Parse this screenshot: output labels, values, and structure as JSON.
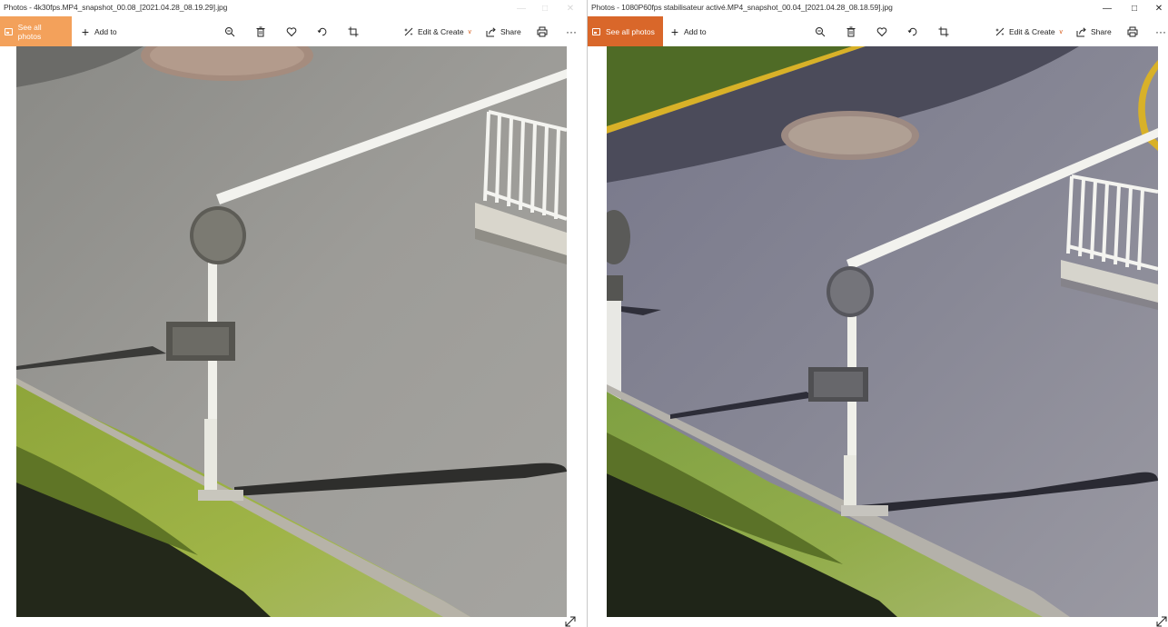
{
  "windows": [
    {
      "title": "Photos - 4k30fps.MP4_snapshot_00.08_[2021.04.28_08.19.29].jpg",
      "see_all_label": "See all photos",
      "add_to_label": "Add to",
      "edit_create_label": "Edit & Create",
      "share_label": "Share",
      "accent": "#f3a15b",
      "photo_alt": "4k30fps snapshot: street sign post on asphalt beside grass verge"
    },
    {
      "title": "Photos - 1080P60fps stabilisateur activé.MP4_snapshot_00.04_[2021.04.28_08.18.59].jpg",
      "see_all_label": "See all photos",
      "add_to_label": "Add to",
      "edit_create_label": "Edit & Create",
      "share_label": "Share",
      "accent": "#d9672a",
      "photo_alt": "1080P60fps stabilized snapshot: street sign post on asphalt beside grass verge"
    }
  ],
  "icons": [
    "minimize-icon",
    "maximize-icon",
    "close-icon",
    "photos-icon",
    "plus-icon",
    "zoom-icon",
    "delete-icon",
    "favorite-icon",
    "rotate-icon",
    "crop-icon",
    "edit-create-icon",
    "share-icon",
    "print-icon",
    "more-icon",
    "expand-icon"
  ]
}
